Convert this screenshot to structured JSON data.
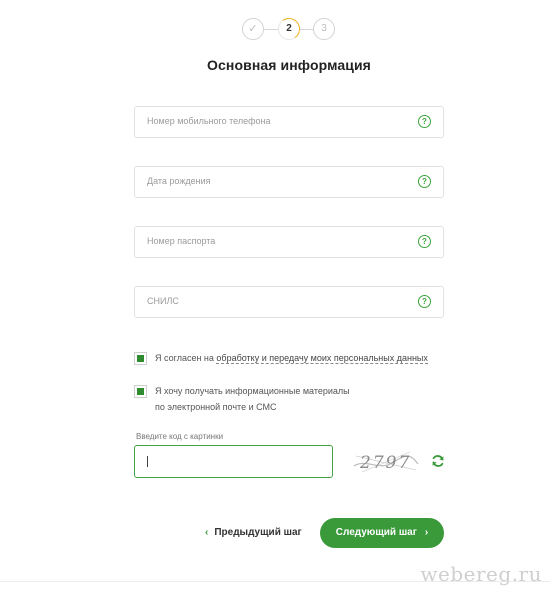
{
  "stepper": {
    "steps": [
      {
        "label": "✓",
        "state": "done"
      },
      {
        "label": "2",
        "state": "current"
      },
      {
        "label": "3",
        "state": "pending"
      }
    ]
  },
  "title": "Основная информация",
  "fields": [
    {
      "placeholder": "Номер мобильного телефона",
      "help": "?"
    },
    {
      "placeholder": "Дата рождения",
      "help": "?"
    },
    {
      "placeholder": "Номер паспорта",
      "help": "?"
    },
    {
      "placeholder": "СНИЛС",
      "help": "?"
    }
  ],
  "consent": {
    "prefix": "Я согласен на ",
    "link": "обработку и передачу моих персональных данных",
    "checked": true
  },
  "newsletter": {
    "line1": "Я хочу получать информационные материалы",
    "line2": "по электронной почте и СМС",
    "checked": true
  },
  "captcha": {
    "label": "Введите код с картинки",
    "value": "",
    "image_text": "2797"
  },
  "nav": {
    "prev_label": "Предыдущий шаг",
    "next_label": "Следующий шаг"
  },
  "watermark": "webereg.ru",
  "colors": {
    "accent": "#3a9a3a",
    "progress": "#f1b31c"
  }
}
